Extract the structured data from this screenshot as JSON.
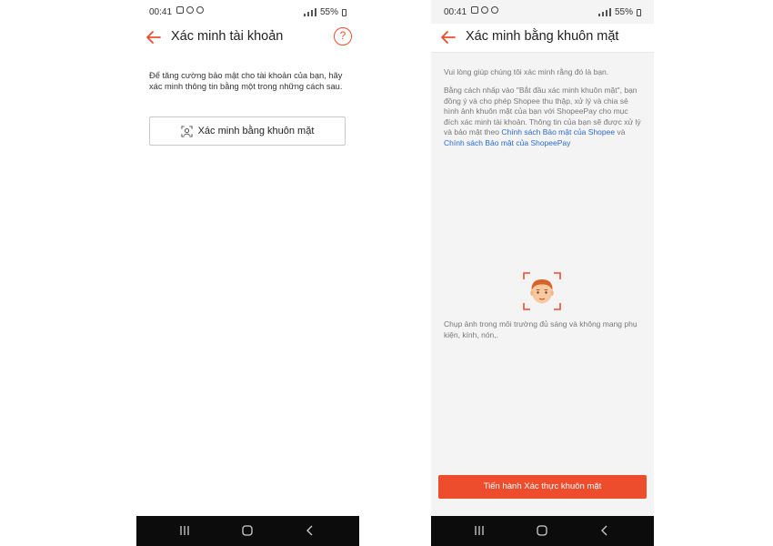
{
  "colors": {
    "accent": "#ee4d2d",
    "link": "#2a6bc9",
    "nav_bar": "#0c0c0c"
  },
  "status_bar": {
    "time": "00:41",
    "battery": "55%"
  },
  "left_screen": {
    "title": "Xác minh tài khoản",
    "help_icon": "?",
    "intro": "Để tăng cường bảo mật cho tài khoản của bạn, hãy xác minh thông tin bằng một trong những cách sau.",
    "face_button_label": "Xác minh bằng khuôn mặt"
  },
  "right_screen": {
    "title": "Xác minh bằng khuôn mặt",
    "help_text": "Vui lòng giúp chúng tôi xác minh rằng đó là bạn.",
    "consent_text": "Bằng cách nhấp vào \"Bắt đầu xác minh khuôn mặt\", bạn đồng ý và cho phép Shopee thu thập, xử lý và chia sẻ hình ảnh khuôn mặt của bạn với ShopeePay cho mục đích xác minh tài khoản. Thông tin của bạn sẽ được xử lý và bảo mật theo ",
    "shopee_policy_link": "Chính sách Bảo mật của Shopee",
    "and_text": " và ",
    "shopeepay_policy_link": "Chính sách Bảo mật của ShopeePay",
    "photo_tip": "Chụp ảnh trong môi trường đủ sáng và không mang phụ kiện, kính, nón,.",
    "proceed_button_label": "Tiến hành Xác thực khuôn mặt"
  },
  "icons": {
    "back": "arrow-left-icon",
    "help": "question-circle-icon",
    "face_scan": "face-scan-icon",
    "face_illustration": "face-illustration-icon",
    "nav_recent": "recent-apps-icon",
    "nav_home": "home-icon",
    "nav_back": "chevron-left-icon"
  }
}
